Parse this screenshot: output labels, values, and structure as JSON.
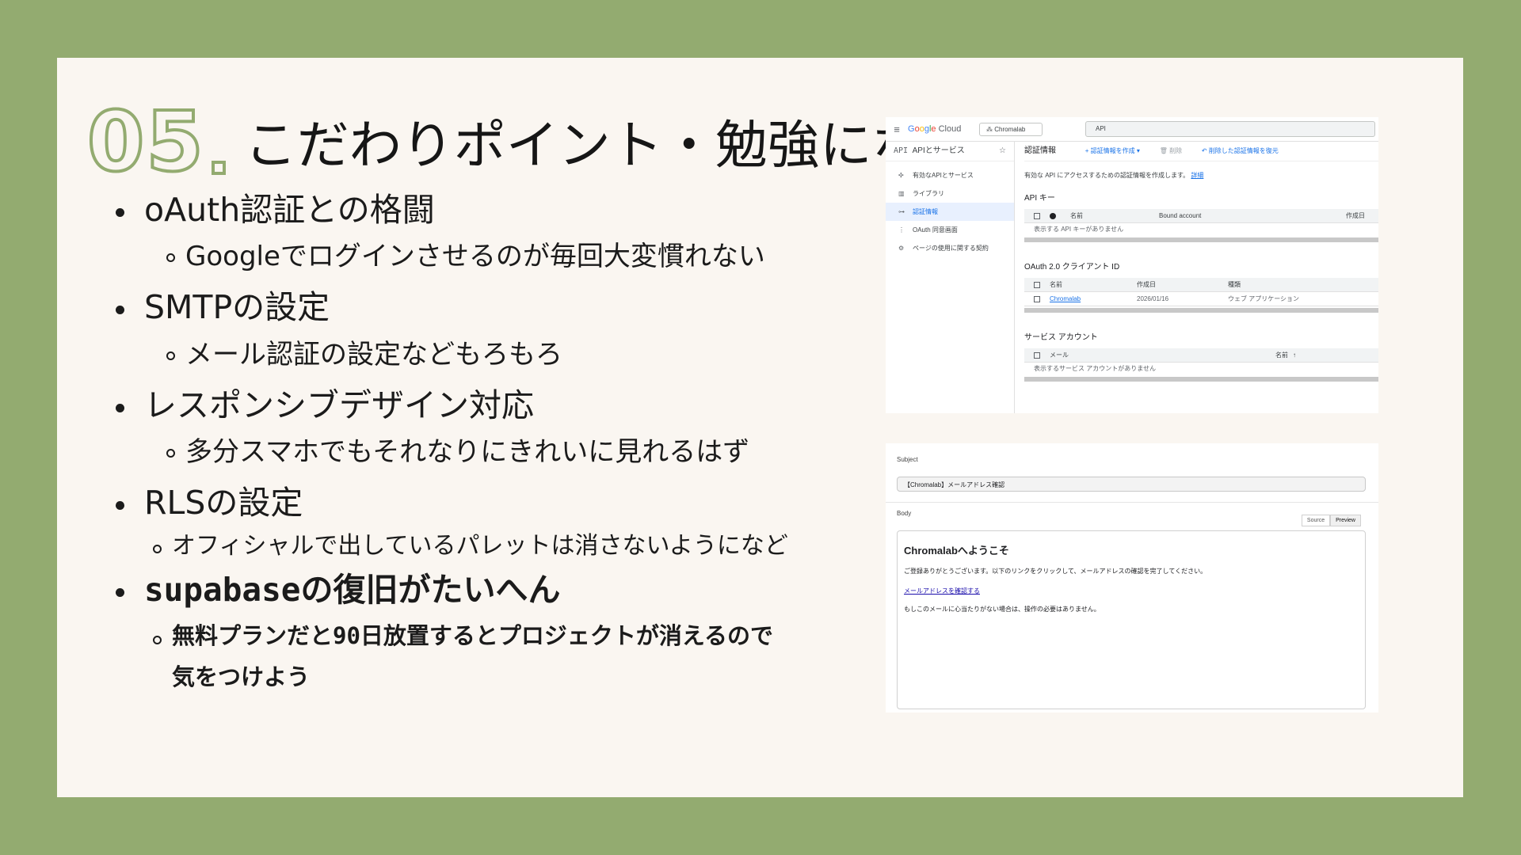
{
  "slide": {
    "number": "05",
    "title": "こだわりポイント・勉強になったこと"
  },
  "bullets": [
    {
      "text": "oAuth認証との格闘",
      "sub": "Googleでログインさせるのが毎回大変慣れない"
    },
    {
      "text": "SMTPの設定",
      "sub": "メール認証の設定などもろもろ"
    },
    {
      "text": "レスポンシブデザイン対応",
      "sub": "多分スマホでもそれなりにきれいに見れるはず"
    },
    {
      "text": "RLSの設定",
      "sub": "オフィシャルで出しているパレットは消さないようになど"
    },
    {
      "text": "supabaseの復旧がたいへん",
      "sub": "無料プランだと90日放置するとプロジェクトが消えるので",
      "sub2": "気をつけよう"
    }
  ],
  "gcloud": {
    "logo": [
      "G",
      "o",
      "o",
      "g",
      "l",
      "e",
      " Cloud"
    ],
    "project": "Chromalab",
    "search": "API",
    "side_header": "APIとサービス",
    "side_items": [
      "有効なAPIとサービス",
      "ライブラリ",
      "認証情報",
      "OAuth 同意画面",
      "ページの使用に関する契約"
    ],
    "main_title": "認証情報",
    "actions": [
      "+ 認証情報を作成 ▾",
      "削除",
      "削除した認証情報を復元"
    ],
    "desc": "有効な API にアクセスするための認証情報を作成します。",
    "desc_link": "詳細",
    "api_key_title": "API キー",
    "api_key_cols": [
      "名前",
      "Bound account",
      "作成日"
    ],
    "api_key_empty": "表示する API キーがありません",
    "oauth_title": "OAuth 2.0 クライアント ID",
    "oauth_cols": [
      "名前",
      "作成日",
      "種類"
    ],
    "oauth_row": {
      "name": "Chromalab",
      "date": "2026/01/16",
      "type": "ウェブ アプリケーション"
    },
    "sa_title": "サービス アカウント",
    "sa_cols": [
      "メール",
      "名前"
    ],
    "sa_empty": "表示するサービス アカウントがありません"
  },
  "email": {
    "subject_label": "Subject",
    "subject": "【Chromalab】メールアドレス確認",
    "body_label": "Body",
    "tab_source": "Source",
    "tab_preview": "Preview",
    "heading": "Chromalabへようこそ",
    "p1": "ご登録ありがとうございます。以下のリンクをクリックして、メールアドレスの確認を完了してください。",
    "link": "メールアドレスを確認する",
    "p2": "もしこのメールに心当たりがない場合は、操作の必要はありません。"
  }
}
